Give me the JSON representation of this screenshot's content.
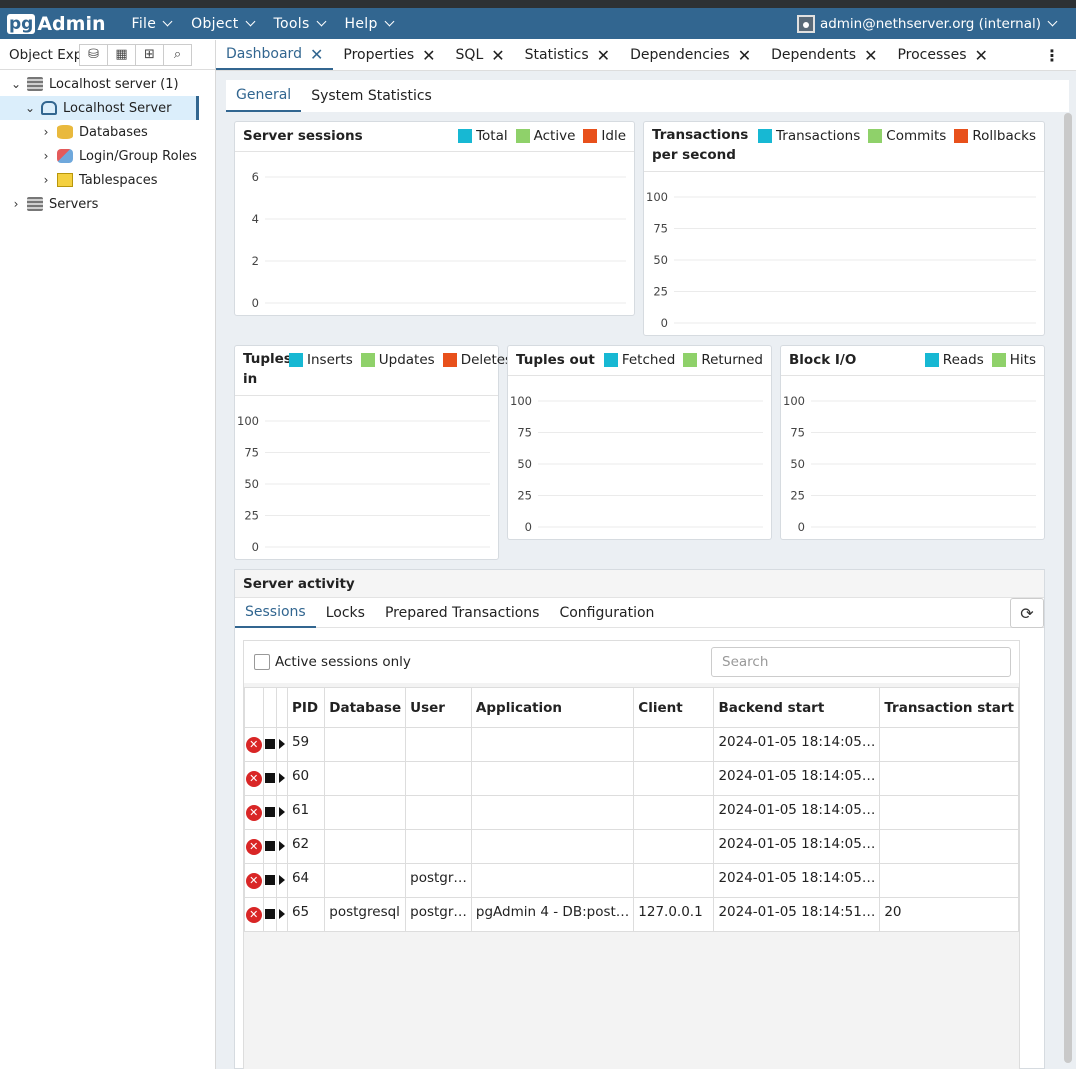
{
  "app": {
    "logo_pg": "pg",
    "logo_admin": "Admin"
  },
  "menu": [
    "File",
    "Object",
    "Tools",
    "Help"
  ],
  "user": {
    "label": "admin@nethserver.org (internal)"
  },
  "left": {
    "title": "Object Explorer",
    "tree": [
      {
        "label": "Localhost server (1)",
        "icon": "server-group-icon"
      },
      {
        "label": "Localhost Server",
        "icon": "postgres-server-icon"
      },
      {
        "label": "Databases",
        "icon": "databases-icon"
      },
      {
        "label": "Login/Group Roles",
        "icon": "roles-icon"
      },
      {
        "label": "Tablespaces",
        "icon": "tablespaces-icon"
      },
      {
        "label": "Servers",
        "icon": "server-group-icon"
      }
    ]
  },
  "tabs": [
    "Dashboard",
    "Properties",
    "SQL",
    "Statistics",
    "Dependencies",
    "Dependents",
    "Processes"
  ],
  "subtabs": [
    "General",
    "System Statistics"
  ],
  "colors": {
    "blue": "#17b8d3",
    "green": "#8fd16a",
    "red": "#e8501b",
    "accent": "#326690"
  },
  "chart_data": [
    {
      "type": "line",
      "title": "Server sessions",
      "legend": [
        "Total",
        "Active",
        "Idle"
      ],
      "yticks": [
        "6",
        "4",
        "2",
        "0"
      ],
      "ylim": [
        0,
        6
      ],
      "series": []
    },
    {
      "type": "line",
      "title": "Transactions per second",
      "legend": [
        "Transactions",
        "Commits",
        "Rollbacks"
      ],
      "yticks": [
        "100",
        "75",
        "50",
        "25",
        "0"
      ],
      "ylim": [
        0,
        100
      ],
      "series": []
    },
    {
      "type": "line",
      "title": "Tuples in",
      "legend": [
        "Inserts",
        "Updates",
        "Deletes"
      ],
      "yticks": [
        "100",
        "75",
        "50",
        "25",
        "0"
      ],
      "ylim": [
        0,
        100
      ],
      "series": []
    },
    {
      "type": "line",
      "title": "Tuples out",
      "legend": [
        "Fetched",
        "Returned"
      ],
      "yticks": [
        "100",
        "75",
        "50",
        "25",
        "0"
      ],
      "ylim": [
        0,
        100
      ],
      "series": []
    },
    {
      "type": "line",
      "title": "Block I/O",
      "legend": [
        "Reads",
        "Hits"
      ],
      "yticks": [
        "100",
        "75",
        "50",
        "25",
        "0"
      ],
      "ylim": [
        0,
        100
      ],
      "series": []
    }
  ],
  "activity": {
    "title": "Server activity",
    "tabs": [
      "Sessions",
      "Locks",
      "Prepared Transactions",
      "Configuration"
    ],
    "active_only": "Active sessions only",
    "search_placeholder": "Search",
    "columns": [
      "PID",
      "Database",
      "User",
      "Application",
      "Client",
      "Backend start",
      "Transaction start"
    ],
    "rows": [
      [
        "59",
        "",
        "",
        "",
        "",
        "2024-01-05 18:14:05…",
        ""
      ],
      [
        "60",
        "",
        "",
        "",
        "",
        "2024-01-05 18:14:05…",
        ""
      ],
      [
        "61",
        "",
        "",
        "",
        "",
        "2024-01-05 18:14:05…",
        ""
      ],
      [
        "62",
        "",
        "",
        "",
        "",
        "2024-01-05 18:14:05…",
        ""
      ],
      [
        "64",
        "",
        "postgr…",
        "",
        "",
        "2024-01-05 18:14:05…",
        ""
      ],
      [
        "65",
        "postgresql",
        "postgr…",
        "pgAdmin 4 - DB:post…",
        "127.0.0.1",
        "2024-01-05 18:14:51…",
        "20"
      ]
    ]
  }
}
